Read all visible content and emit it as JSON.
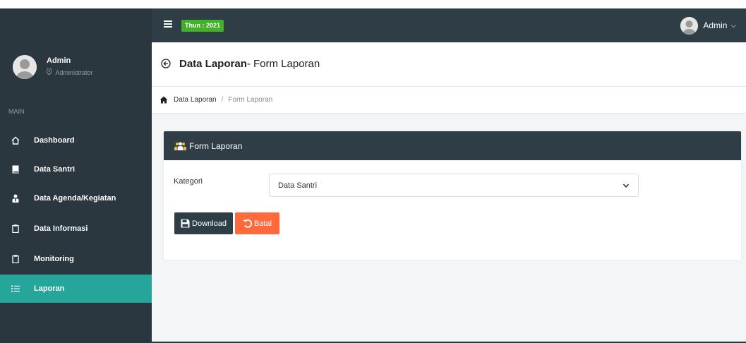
{
  "topbar": {
    "year_badge": "Thun : 2021",
    "user_name": "Admin",
    "user_chevron": "⌵"
  },
  "sidebar": {
    "profile": {
      "name": "Admin",
      "role": "Administrator"
    },
    "section_label": "MAIN",
    "items": [
      {
        "label": "Dashboard",
        "icon": "home-icon",
        "active": false
      },
      {
        "label": "Data Santri",
        "icon": "book-icon",
        "active": false
      },
      {
        "label": "Data Agenda/Kegiatan",
        "icon": "user-tie-icon",
        "active": false
      },
      {
        "label": "Data Informasi",
        "icon": "clipboard-icon",
        "active": false
      },
      {
        "label": "Monitoring",
        "icon": "clipboard-icon",
        "active": false
      },
      {
        "label": "Laporan",
        "icon": "list-icon",
        "active": true
      }
    ]
  },
  "page": {
    "title_bold": "Data Laporan",
    "title_rest": "- Form Laporan"
  },
  "breadcrumb": {
    "link": "Data Laporan",
    "separator": "/",
    "current": "Form Laporan"
  },
  "card": {
    "title": "Form Laporan",
    "kategori_label": "Kategori",
    "kategori_value": "Data Santri",
    "download_label": "Download",
    "batal_label": "Batal"
  },
  "colors": {
    "sidebar_bg": "#2a373e",
    "topbar_bg": "#2f3e46",
    "active_item": "#26a69a",
    "year_badge": "#43b02a",
    "batal_button": "#ff6a3d"
  }
}
